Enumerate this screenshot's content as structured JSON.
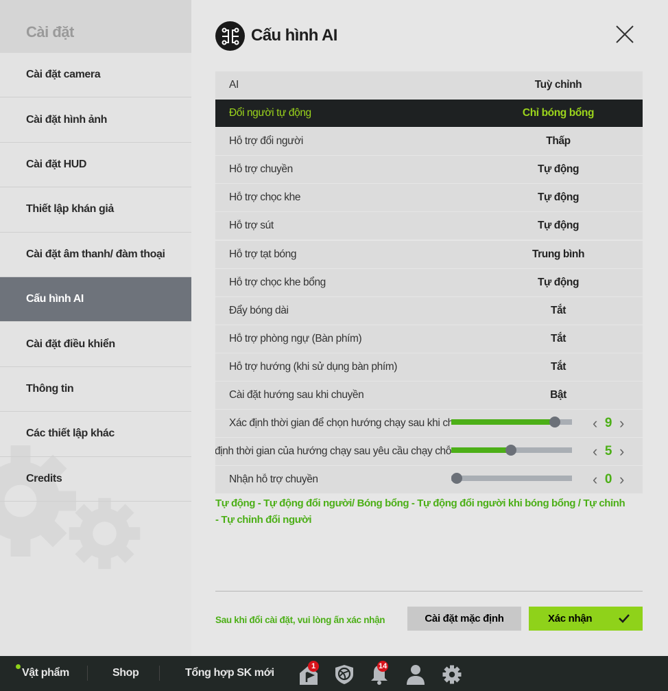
{
  "sidebar": {
    "title": "Cài đặt",
    "items": [
      {
        "label": "Cài đặt camera"
      },
      {
        "label": "Cài đặt hình ảnh"
      },
      {
        "label": "Cài đặt HUD"
      },
      {
        "label": "Thiết lập khán giả"
      },
      {
        "label": "Cài đặt âm thanh/ đàm thoại"
      },
      {
        "label": "Cấu hình AI",
        "active": true
      },
      {
        "label": "Cài đặt điều khiển"
      },
      {
        "label": "Thông tin"
      },
      {
        "label": "Các thiết lập khác"
      },
      {
        "label": "Credits"
      }
    ]
  },
  "main": {
    "title": "Cấu hình AI",
    "icon": "ai-circuit-icon",
    "rows": [
      {
        "label": "AI",
        "value": "Tuỳ chỉnh"
      },
      {
        "label": "Đổi người tự động",
        "value": "Chỉ bóng bổng",
        "selected": true
      },
      {
        "label": "Hỗ trợ đổi người",
        "value": "Thấp"
      },
      {
        "label": "Hỗ trợ chuyền",
        "value": "Tự động"
      },
      {
        "label": "Hỗ trợ chọc khe",
        "value": "Tự động"
      },
      {
        "label": "Hỗ trợ sút",
        "value": "Tự động"
      },
      {
        "label": "Hỗ trợ tạt bóng",
        "value": "Trung bình"
      },
      {
        "label": "Hỗ trợ chọc khe bổng",
        "value": "Tự động"
      },
      {
        "label": "Đẩy bóng dài",
        "value": "Tắt"
      },
      {
        "label": "Hỗ trợ phòng ngự (Bàn phím)",
        "value": "Tắt"
      },
      {
        "label": "Hỗ trợ hướng (khi sử dụng bàn phím)",
        "value": "Tắt"
      },
      {
        "label": "Cài đặt hướng sau khi chuyền",
        "value": "Bật"
      }
    ],
    "sliders": [
      {
        "label": "Xác định thời gian để chọn hướng chạy sau khi chuyền",
        "value": "9",
        "fraction": 0.9
      },
      {
        "label": "yết định thời gian của hướng chạy sau yêu cầu chạy chỗ",
        "value": "5",
        "fraction": 0.5
      },
      {
        "label": "Nhận hỗ trợ chuyền",
        "value": "0",
        "fraction": 0
      }
    ],
    "note": "Tự động - Tự động đổi người/ Bóng bổng - Tự động đổi người khi bóng bổng / Tự chỉnh - Tự chỉnh đổi người",
    "hint": "Sau khi đổi cài đặt, vui lòng ấn xác nhận",
    "default_button": "Cài đặt mặc định",
    "confirm_button": "Xác nhận"
  },
  "colors": {
    "accent": "#8fd21a",
    "green_text": "#4caf17",
    "active_item": "#6e737b",
    "bar": "#222826",
    "badge": "#d8131b"
  },
  "bottombar": {
    "links": [
      "Vật phẩm",
      "Shop",
      "Tổng hợp SK mới"
    ],
    "badges": {
      "home": "1",
      "bell": "14"
    },
    "icons": [
      "home-flag-icon",
      "shield-ball-icon",
      "bell-icon",
      "user-icon",
      "gear-icon"
    ]
  }
}
